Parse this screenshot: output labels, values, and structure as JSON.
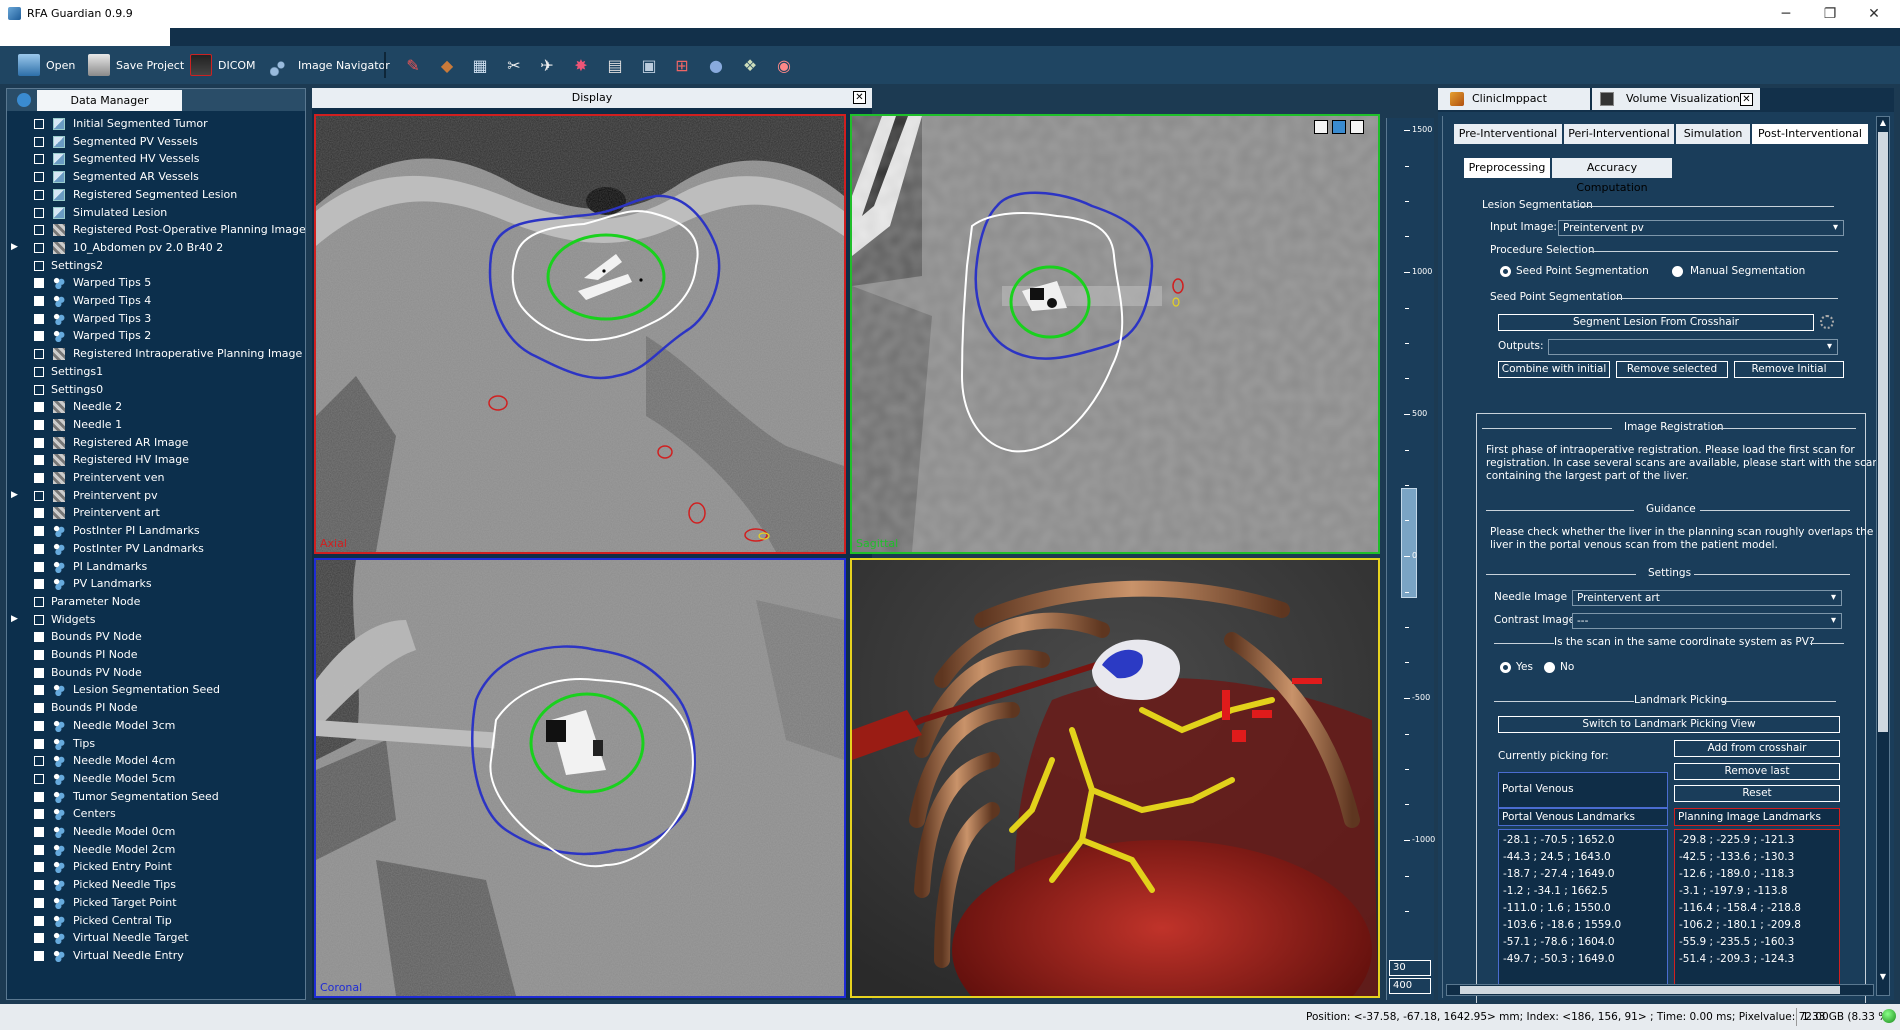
{
  "app": {
    "title": "RFA Guardian 0.9.9"
  },
  "window_controls": {
    "minimize": "─",
    "maximize": "❐",
    "close": "✕"
  },
  "toolbar": {
    "open_label": "Open",
    "save_label": "Save Project",
    "dicom_label": "DICOM",
    "navigator_label": "Image Navigator"
  },
  "data_manager": {
    "tab_label": "Data Manager",
    "items": [
      {
        "label": "Initial Segmented Tumor",
        "icon": "volume",
        "checked": false,
        "expandable": false,
        "indent": 1
      },
      {
        "label": "Segmented PV Vessels",
        "icon": "volume",
        "checked": false,
        "expandable": false,
        "indent": 1
      },
      {
        "label": "Segmented HV Vessels",
        "icon": "volume",
        "checked": false,
        "expandable": false,
        "indent": 1
      },
      {
        "label": "Segmented AR Vessels",
        "icon": "volume",
        "checked": false,
        "expandable": false,
        "indent": 1
      },
      {
        "label": "Registered Segmented Lesion",
        "icon": "volume",
        "checked": false,
        "expandable": false,
        "indent": 1
      },
      {
        "label": "Simulated Lesion",
        "icon": "volume",
        "checked": false,
        "expandable": false,
        "indent": 1
      },
      {
        "label": "Registered Post-Operative Planning Image",
        "icon": "image",
        "checked": false,
        "expandable": false,
        "indent": 1
      },
      {
        "label": "10_Abdomen pv  2.0  Br40  2",
        "icon": "image",
        "checked": false,
        "expandable": true,
        "indent": 1
      },
      {
        "label": "Settings2",
        "icon": "none",
        "checked": false,
        "expandable": false,
        "indent": 0
      },
      {
        "label": "Warped Tips 5",
        "icon": "points",
        "checked": true,
        "expandable": false,
        "indent": 1
      },
      {
        "label": "Warped Tips 4",
        "icon": "points",
        "checked": true,
        "expandable": false,
        "indent": 1
      },
      {
        "label": "Warped Tips 3",
        "icon": "points",
        "checked": true,
        "expandable": false,
        "indent": 1
      },
      {
        "label": "Warped Tips 2",
        "icon": "points",
        "checked": true,
        "expandable": false,
        "indent": 1
      },
      {
        "label": "Registered Intraoperative Planning Image",
        "icon": "image",
        "checked": false,
        "expandable": false,
        "indent": 1
      },
      {
        "label": "Settings1",
        "icon": "none",
        "checked": false,
        "expandable": false,
        "indent": 0
      },
      {
        "label": "Settings0",
        "icon": "none",
        "checked": false,
        "expandable": false,
        "indent": 0
      },
      {
        "label": "Needle 2",
        "icon": "image",
        "checked": true,
        "expandable": false,
        "indent": 1
      },
      {
        "label": "Needle 1",
        "icon": "image",
        "checked": true,
        "expandable": false,
        "indent": 1
      },
      {
        "label": "Registered AR Image",
        "icon": "image",
        "checked": true,
        "expandable": false,
        "indent": 1
      },
      {
        "label": "Registered HV Image",
        "icon": "image",
        "checked": true,
        "expandable": false,
        "indent": 1
      },
      {
        "label": "Preintervent ven",
        "icon": "image",
        "checked": true,
        "expandable": false,
        "indent": 1
      },
      {
        "label": "Preintervent pv",
        "icon": "image",
        "checked": false,
        "expandable": true,
        "indent": 1
      },
      {
        "label": "Preintervent art",
        "icon": "image",
        "checked": true,
        "expandable": false,
        "indent": 1
      },
      {
        "label": "PostInter PI Landmarks",
        "icon": "points",
        "checked": true,
        "expandable": false,
        "indent": 1
      },
      {
        "label": "PostInter PV Landmarks",
        "icon": "points",
        "checked": true,
        "expandable": false,
        "indent": 1
      },
      {
        "label": "PI Landmarks",
        "icon": "points",
        "checked": true,
        "expandable": false,
        "indent": 1
      },
      {
        "label": "PV Landmarks",
        "icon": "points",
        "checked": true,
        "expandable": false,
        "indent": 1
      },
      {
        "label": "Parameter Node",
        "icon": "none",
        "checked": false,
        "expandable": false,
        "indent": 0
      },
      {
        "label": "Widgets",
        "icon": "none",
        "checked": false,
        "expandable": true,
        "indent": 0
      },
      {
        "label": "Bounds PV Node",
        "icon": "none",
        "checked": true,
        "expandable": false,
        "indent": 0
      },
      {
        "label": "Bounds PI Node",
        "icon": "none",
        "checked": true,
        "expandable": false,
        "indent": 0
      },
      {
        "label": "Bounds PV Node",
        "icon": "none",
        "checked": true,
        "expandable": false,
        "indent": 0
      },
      {
        "label": "Lesion Segmentation Seed",
        "icon": "points",
        "checked": true,
        "expandable": false,
        "indent": 1
      },
      {
        "label": "Bounds PI Node",
        "icon": "none",
        "checked": true,
        "expandable": false,
        "indent": 0
      },
      {
        "label": "Needle Model 3cm",
        "icon": "points",
        "checked": true,
        "expandable": false,
        "indent": 1
      },
      {
        "label": "Tips",
        "icon": "points",
        "checked": true,
        "expandable": false,
        "indent": 1
      },
      {
        "label": "Needle Model 4cm",
        "icon": "points",
        "checked": false,
        "expandable": false,
        "indent": 1
      },
      {
        "label": "Needle Model 5cm",
        "icon": "points",
        "checked": false,
        "expandable": false,
        "indent": 1
      },
      {
        "label": "Tumor Segmentation Seed",
        "icon": "points",
        "checked": true,
        "expandable": false,
        "indent": 1
      },
      {
        "label": "Centers",
        "icon": "points",
        "checked": true,
        "expandable": false,
        "indent": 1
      },
      {
        "label": "Needle Model 0cm",
        "icon": "points",
        "checked": true,
        "expandable": false,
        "indent": 1
      },
      {
        "label": "Needle Model 2cm",
        "icon": "points",
        "checked": true,
        "expandable": false,
        "indent": 1
      },
      {
        "label": "Picked Entry Point",
        "icon": "points",
        "checked": true,
        "expandable": false,
        "indent": 1
      },
      {
        "label": "Picked Needle Tips",
        "icon": "points",
        "checked": true,
        "expandable": false,
        "indent": 1
      },
      {
        "label": "Picked Target Point",
        "icon": "points",
        "checked": true,
        "expandable": false,
        "indent": 1
      },
      {
        "label": "Picked Central Tip",
        "icon": "points",
        "checked": true,
        "expandable": false,
        "indent": 1
      },
      {
        "label": "Virtual Needle Target",
        "icon": "points",
        "checked": true,
        "expandable": false,
        "indent": 1
      },
      {
        "label": "Virtual Needle Entry",
        "icon": "points",
        "checked": true,
        "expandable": false,
        "indent": 1
      }
    ]
  },
  "display": {
    "title": "Display",
    "close": "✕",
    "views": {
      "axial": "Axial",
      "sagittal": "Sagittal",
      "coronal": "Coronal"
    },
    "colors": {
      "axial": "#d11f1f",
      "sagittal": "#1fbf2a",
      "coronal": "#1f2bd6",
      "render3d": "#e6d21f"
    }
  },
  "level_slider": {
    "ticks": [
      "1500",
      "1000",
      "500",
      "0",
      "-500",
      "-1000"
    ],
    "level": "30",
    "window": "400"
  },
  "right_panel": {
    "tabs": [
      "ClinicImppact",
      "Volume Visualization"
    ],
    "phase_tabs": [
      "Pre-Interventional",
      "Peri-Interventional",
      "Simulation",
      "Post-Interventional"
    ],
    "sub_tabs": [
      "Preprocessing",
      "Accuracy Computation"
    ],
    "lesion_segmentation": {
      "title": "Lesion Segmentation",
      "input_label": "Input Image:",
      "input_value": "Preintervent pv",
      "procedure_title": "Procedure Selection",
      "option_seed": "Seed Point Segmentation",
      "option_manual": "Manual Segmentation",
      "seed_title": "Seed Point Segmentation",
      "segment_button": "Segment Lesion From Crosshair",
      "outputs_label": "Outputs:",
      "outputs_value": "",
      "combine_button": "Combine with initial",
      "remove_selected_button": "Remove selected",
      "remove_initial_button": "Remove Initial"
    },
    "image_registration": {
      "title": "Image Registration",
      "text_lines": [
        "First phase of intraoperative registration. Please load the first scan for",
        "registration. In case several scans are available, please start with the scan",
        "containing the largest part of the liver."
      ],
      "guidance_title": "Guidance",
      "guidance_lines": [
        "Please check whether the liver in the planning scan roughly overlaps the",
        "liver in the portal venous scan from the patient model."
      ],
      "settings_title": "Settings",
      "needle_label": "Needle Image",
      "needle_value": "Preintervent art",
      "contrast_label": "Contrast Image",
      "contrast_value": "---",
      "coord_question": "Is the scan in the same coordinate system as PV?",
      "yes": "Yes",
      "no": "No",
      "landmark_title": "Landmark Picking",
      "switch_button": "Switch to Landmark Picking View",
      "picking_label": "Currently picking for:",
      "picking_value": "Portal Venous",
      "add_button": "Add from crosshair",
      "remove_last_button": "Remove last",
      "reset_button": "Reset",
      "pv_header": "Portal Venous Landmarks",
      "pi_header": "Planning Image Landmarks",
      "pv_landmarks": [
        "-28.1 ; -70.5 ; 1652.0",
        "-44.3 ; 24.5 ; 1643.0",
        "-18.7 ; -27.4 ; 1649.0",
        "-1.2 ; -34.1 ; 1662.5",
        "-111.0 ; 1.6 ; 1550.0",
        "-103.6 ; -18.6 ; 1559.0",
        "-57.1 ; -78.6 ; 1604.0",
        "-49.7 ; -50.3 ; 1649.0"
      ],
      "pi_landmarks": [
        "-29.8 ; -225.9 ; -121.3",
        "-42.5 ; -133.6 ; -130.3",
        "-12.6 ; -189.0 ; -118.3",
        "-3.1 ; -197.9 ; -113.8",
        "-116.4 ; -158.4 ; -218.8",
        "-106.2 ; -180.1 ; -209.8",
        "-55.9 ; -235.5 ; -160.3",
        "-51.4 ; -209.3 ; -124.3"
      ]
    }
  },
  "status_bar": {
    "text": "Position: <-37.58, -67.18, 1642.95> mm; Index: <186, 156, 91> ; Time: 0.00 ms; Pixelvalue: 72.00",
    "memory": "1.33 GB (8.33 %)"
  }
}
